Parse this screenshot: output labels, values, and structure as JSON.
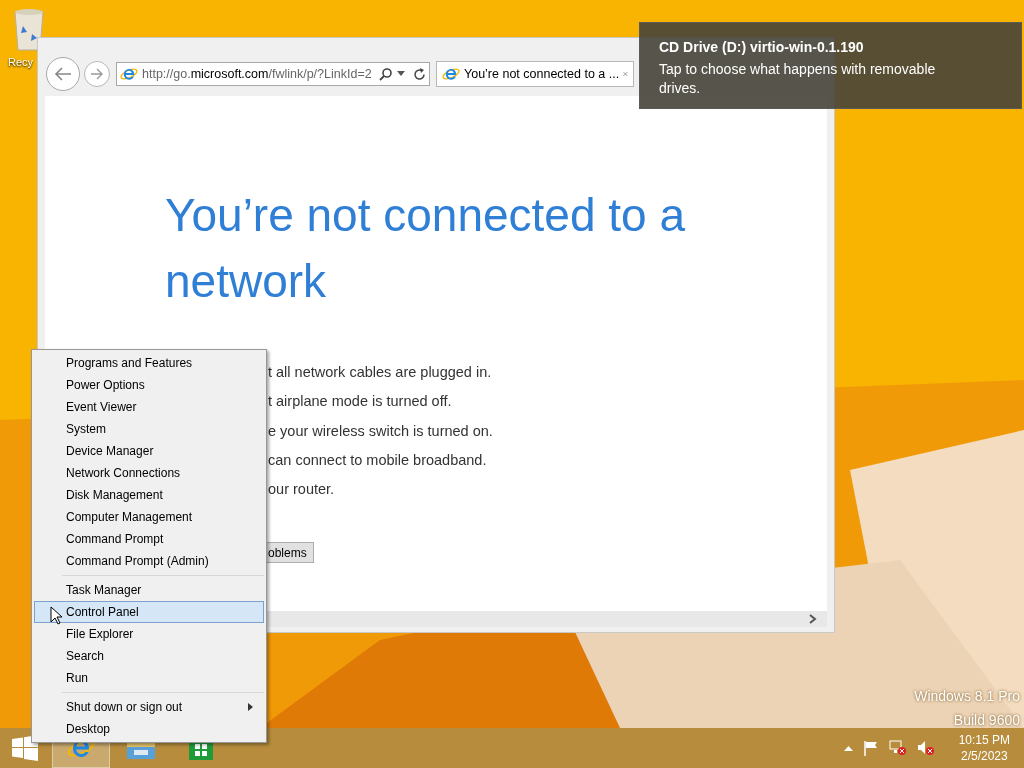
{
  "desktop": {
    "icons": [
      {
        "label": "Recy"
      }
    ],
    "edition": [
      "Windows 8.1 Pro",
      "Build 9600"
    ]
  },
  "browser": {
    "address": {
      "scheme": "http://go.",
      "domain": "microsoft.com",
      "path": "/fwlink/p/?LinkId=2"
    },
    "tabs": [
      {
        "title": "You’re not connected to a ...",
        "selected": true
      }
    ],
    "heading": "You’re not connected to a network",
    "lines": [
      "t all network cables are plugged in.",
      "t airplane mode is turned off.",
      "e your wireless switch is turned on.",
      "can connect to mobile broadband.",
      "our router."
    ],
    "button": "oblems"
  },
  "notification": {
    "title": "CD Drive (D:) virtio-win-0.1.190",
    "body": "Tap to choose what happens with removable drives."
  },
  "menu": {
    "groups": [
      [
        {
          "label": "Programs and Features",
          "selected": false
        },
        {
          "label": "Power Options",
          "selected": false
        },
        {
          "label": "Event Viewer",
          "selected": false
        },
        {
          "label": "System",
          "selected": false
        },
        {
          "label": "Device Manager",
          "selected": false
        },
        {
          "label": "Network Connections",
          "selected": false
        },
        {
          "label": "Disk Management",
          "selected": false
        },
        {
          "label": "Computer Management",
          "selected": false
        },
        {
          "label": "Command Prompt",
          "selected": false
        },
        {
          "label": "Command Prompt (Admin)",
          "selected": false
        }
      ],
      [
        {
          "label": "Task Manager",
          "selected": false
        },
        {
          "label": "Control Panel",
          "selected": true
        },
        {
          "label": "File Explorer",
          "selected": false
        },
        {
          "label": "Search",
          "selected": false
        },
        {
          "label": "Run",
          "selected": false
        }
      ],
      [
        {
          "label": "Shut down or sign out",
          "selected": false,
          "submenu": true
        },
        {
          "label": "Desktop",
          "selected": false
        }
      ]
    ]
  },
  "taskbar": {
    "apps": [
      {
        "kind": "browser",
        "active": true
      },
      {
        "kind": "explorer",
        "active": false
      },
      {
        "kind": "store",
        "active": false
      }
    ],
    "time": "10:15 PM",
    "date": "2/5/2023"
  }
}
